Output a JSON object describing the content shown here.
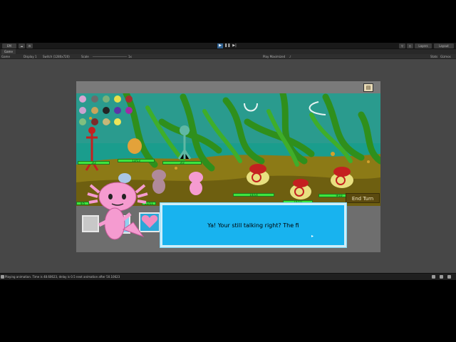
{
  "editor": {
    "toolbar": {
      "account_label": "EM",
      "layers_label": "Layers",
      "layout_label": "Layout"
    },
    "tab": {
      "label": "Game"
    },
    "gamebar": {
      "view_label": "Game",
      "display_label": "Display 1",
      "resolution_label": "Switch (1280x720)",
      "scale_label": "Scale",
      "scale_value": "1x",
      "play_mode_label": "Play Maximized",
      "stats_label": "Stats",
      "gizmos_label": "Gizmos"
    },
    "status": {
      "text": "Playing animation. Time is 48.60623, delay is 0.5 next animation after 50.10623"
    }
  },
  "game": {
    "hp_labels": [
      "3/3",
      "13/13",
      "3/3",
      "14/14",
      "10/10",
      "9/10",
      "4/5",
      "11/11"
    ],
    "end_turn_label": "End Turn",
    "dialog": {
      "text": "Ya! Your still talking right? The fi"
    },
    "colors": {
      "hp_green": "#3ee53e",
      "dialog_blue": "#18b3ef",
      "end_turn": "#5b4a0f",
      "character_pink": "#f59bd0"
    }
  }
}
